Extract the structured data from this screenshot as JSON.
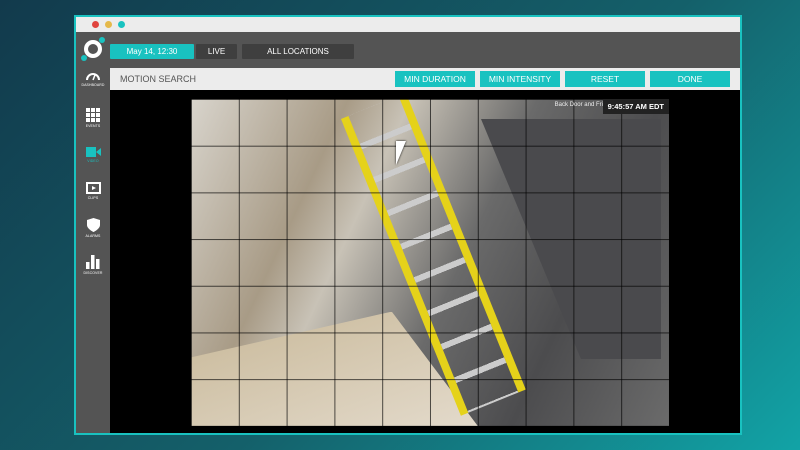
{
  "window": {
    "controls": [
      "close",
      "minimize",
      "maximize"
    ]
  },
  "topbar": {
    "date": "May 14, 12:30",
    "live": "LIVE",
    "locations": "ALL LOCATIONS"
  },
  "sidebar": {
    "items": [
      {
        "label": "DASHBOARD",
        "icon": "gauge-icon"
      },
      {
        "label": "EVENTS",
        "icon": "grid-icon"
      },
      {
        "label": "VIDEO",
        "icon": "video-camera-icon",
        "active": true
      },
      {
        "label": "CLIPS",
        "icon": "film-icon"
      },
      {
        "label": "ALARMS",
        "icon": "shield-icon"
      },
      {
        "label": "DISCOVER",
        "icon": "bar-chart-icon"
      }
    ]
  },
  "header": {
    "title": "MOTION SEARCH",
    "buttons": {
      "min_duration": "MIN DURATION",
      "min_intensity": "MIN INTENSITY",
      "reset": "RESET",
      "done": "DONE"
    }
  },
  "video": {
    "camera_name": "Back Door and Fridge",
    "timestamp": "9:45:57 AM EDT",
    "grid": {
      "columns": 10,
      "rows": 7
    }
  },
  "colors": {
    "accent": "#19c2c0",
    "chrome": "#545454"
  }
}
